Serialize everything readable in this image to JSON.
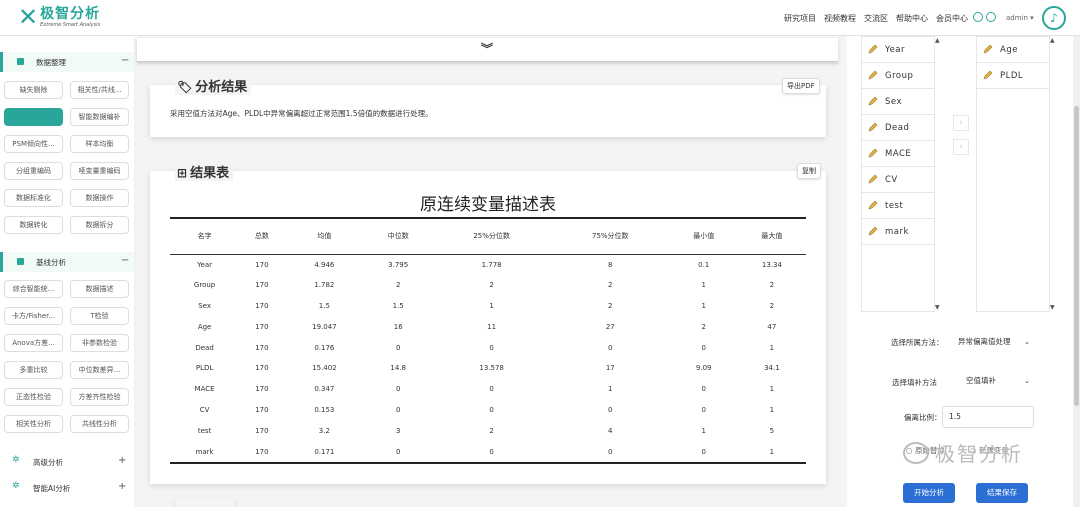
{
  "brand": {
    "name": "极智分析",
    "tagline": "Extreme Smart Analysis"
  },
  "nav": [
    "研究项目",
    "视频教程",
    "交流区",
    "帮助中心",
    "会员中心"
  ],
  "user": {
    "name": "admin"
  },
  "sidebar": {
    "sections": [
      {
        "label": "数据整理",
        "toggle": "−"
      },
      {
        "label": "基线分析",
        "toggle": "−"
      },
      {
        "label": "高级分析",
        "toggle": "+"
      },
      {
        "label": "智能AI分析",
        "toggle": "+"
      }
    ],
    "data_buttons": [
      "缺失剔除",
      "相关性/共线...",
      "异常值处理",
      "智能数据编补",
      "PSM倾向性...",
      "样本均衡",
      "分组重编码",
      "哑变量重编码",
      "数据标准化",
      "数据操作",
      "数据转化",
      "数据拆分"
    ],
    "baseline_buttons": [
      "综合智能统...",
      "数据描述",
      "卡方/Fisher...",
      "T检验",
      "Anova方差...",
      "非参数检验",
      "多重比较",
      "中位数差异...",
      "正态性检验",
      "方差齐性检验",
      "相关性分析",
      "共线性分析"
    ]
  },
  "main": {
    "result_title": "分析结果",
    "export_pdf": "导出PDF",
    "description": "采用空值方法对Age、PLDL中异常偏离超过正常范围1.5倍值的数据进行处理。",
    "table_section_title": "结果表",
    "copy_label": "复制",
    "table_title": "原连续变量描述表",
    "table_headers": [
      "名字",
      "总数",
      "均值",
      "中位数",
      "25%分位数",
      "75%分位数",
      "最小值",
      "最大值"
    ],
    "table_rows": [
      [
        "Year",
        "170",
        "4.946",
        "3.795",
        "1.778",
        "8",
        "0.1",
        "13.34"
      ],
      [
        "Group",
        "170",
        "1.782",
        "2",
        "2",
        "2",
        "1",
        "2"
      ],
      [
        "Sex",
        "170",
        "1.5",
        "1.5",
        "1",
        "2",
        "1",
        "2"
      ],
      [
        "Age",
        "170",
        "19.047",
        "16",
        "11",
        "27",
        "2",
        "47"
      ],
      [
        "Dead",
        "170",
        "0.176",
        "0",
        "0",
        "0",
        "0",
        "1"
      ],
      [
        "PLDL",
        "170",
        "15.402",
        "14.8",
        "13.578",
        "17",
        "9.09",
        "34.1"
      ],
      [
        "MACE",
        "170",
        "0.347",
        "0",
        "0",
        "1",
        "0",
        "1"
      ],
      [
        "CV",
        "170",
        "0.153",
        "0",
        "0",
        "0",
        "0",
        "1"
      ],
      [
        "test",
        "170",
        "3.2",
        "3",
        "2",
        "4",
        "1",
        "5"
      ],
      [
        "mark",
        "170",
        "0.171",
        "0",
        "0",
        "0",
        "0",
        "1"
      ]
    ]
  },
  "right_panel": {
    "available_vars": [
      "Year",
      "Group",
      "Sex",
      "Dead",
      "MACE",
      "CV",
      "test",
      "mark"
    ],
    "selected_vars": [
      "Age",
      "PLDL"
    ],
    "method_label": "选择所属方法：",
    "method_value": "异常偏离值处理",
    "fill_label": "选择填补方法",
    "fill_value": "空值填补",
    "ratio_label": "偏离比例：",
    "ratio_value": "1.5",
    "radio_a": "原始替换",
    "radio_b": "新建变量",
    "start_button": "开始分析",
    "save_button": "结果保存"
  },
  "watermark": "极智分析",
  "colors": {
    "accent": "#2aa59a",
    "button_blue": "#2b6fd4"
  }
}
